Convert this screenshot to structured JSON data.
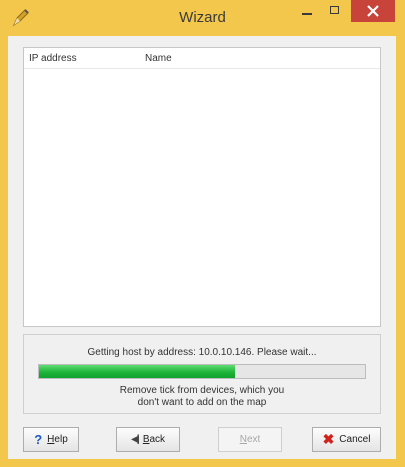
{
  "window": {
    "title": "Wizard",
    "accent_color": "#f3c64c",
    "close_color": "#c8443b"
  },
  "list": {
    "columns": [
      "IP address",
      "Name"
    ],
    "rows": []
  },
  "status": {
    "message": "Getting host by address: 10.0.10.146. Please wait...",
    "progress_percent": 60,
    "hint": "Remove tick from devices, which you don't want to add on the map",
    "hint_line1": "Remove tick from devices, which you",
    "hint_line2": "don't want to add on the map"
  },
  "buttons": {
    "help": "Help",
    "back": "Back",
    "next": "Next",
    "cancel": "Cancel"
  },
  "icons": {
    "app": "pencil-icon",
    "help": "question-mark-icon",
    "back": "back-arrow-icon",
    "cancel": "red-x-icon"
  }
}
